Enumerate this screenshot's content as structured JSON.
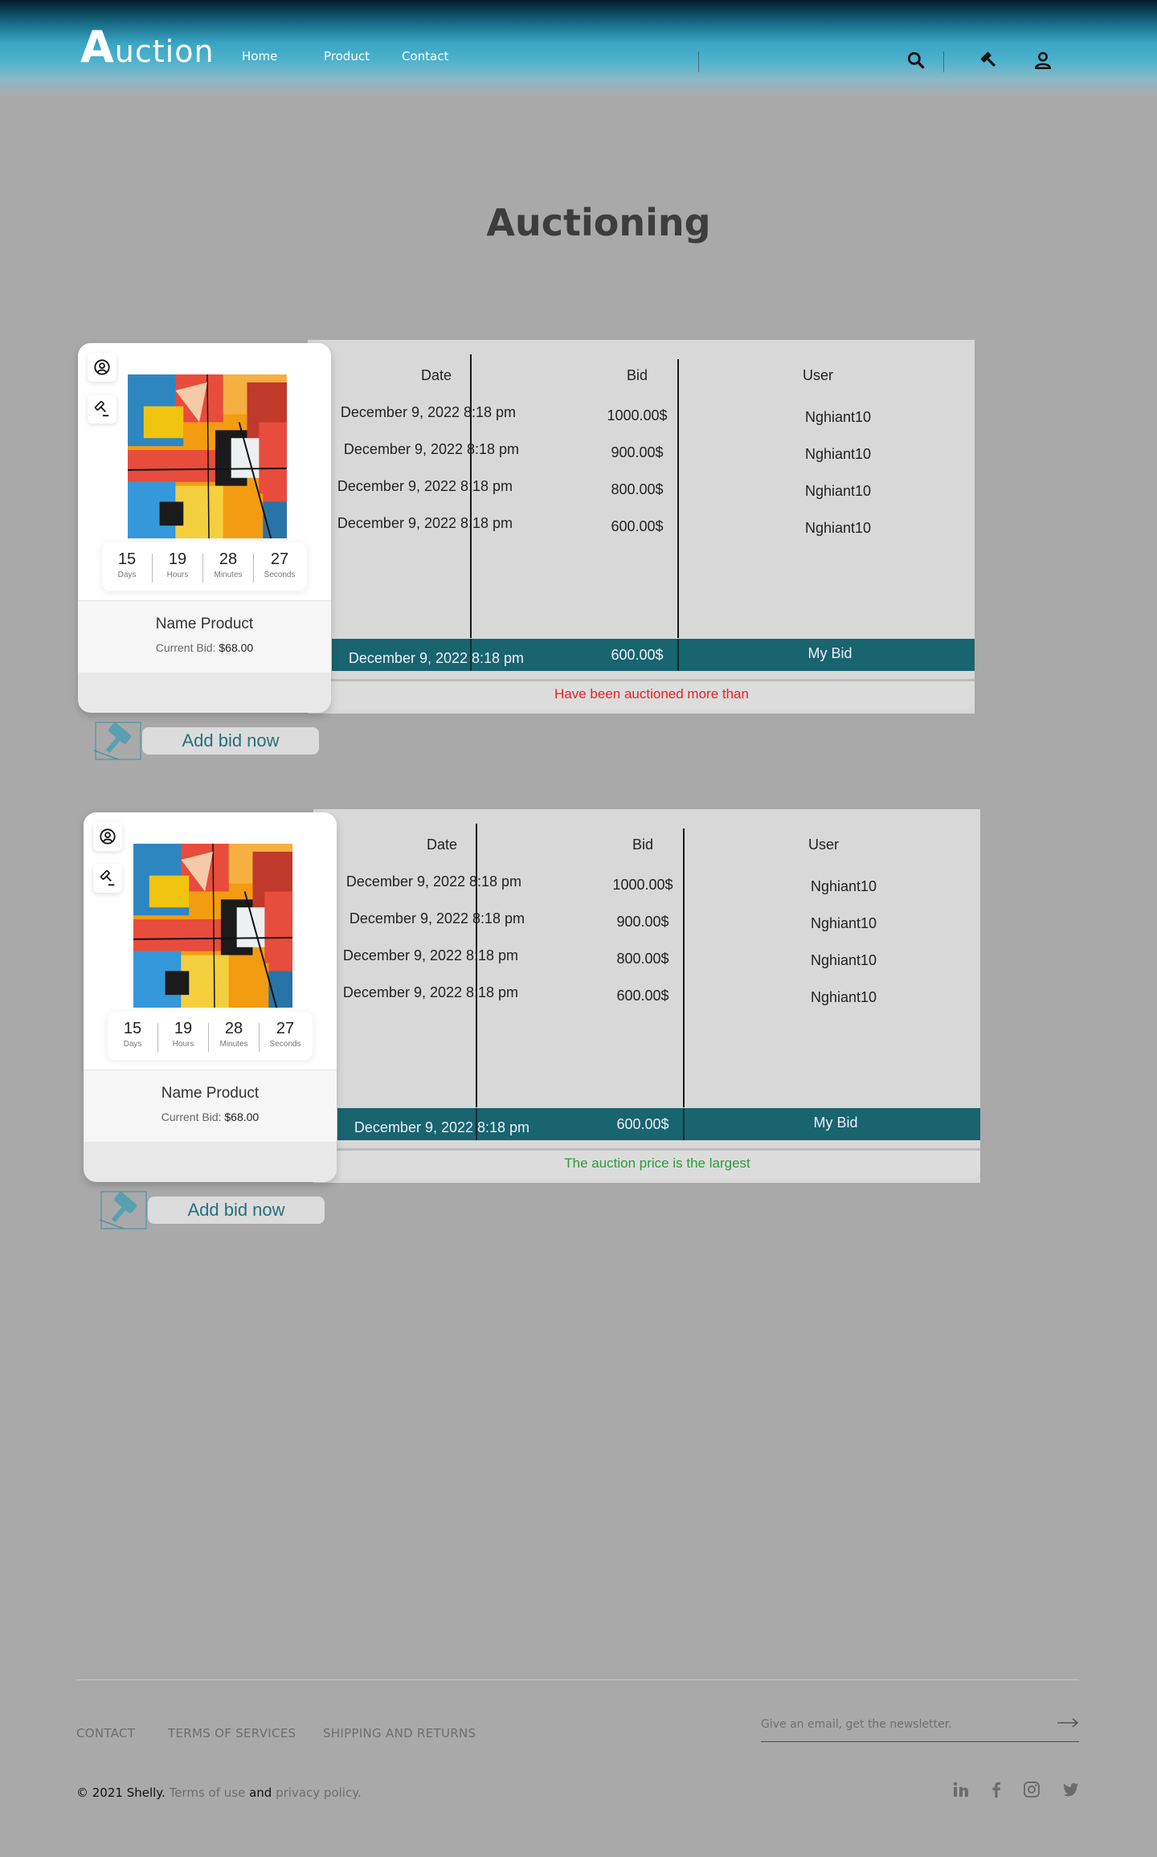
{
  "header": {
    "logo_initial": "A",
    "logo_rest": "uction",
    "nav": [
      "Home",
      "Product",
      "Contact"
    ],
    "icons": [
      "search-icon",
      "gavel-icon",
      "user-icon"
    ]
  },
  "page": {
    "title": "Auctioning"
  },
  "table_headers": {
    "date": "Date",
    "bid": "Bid",
    "user": "User"
  },
  "auctions": [
    {
      "rows": [
        {
          "date": "December 9, 2022 8:18 pm",
          "bid": "1000.00$",
          "user": "Nghiant10"
        },
        {
          "date": "December 9, 2022 8:18 pm",
          "bid": "900.00$",
          "user": "Nghiant10"
        },
        {
          "date": "December 9, 2022 8:18 pm",
          "bid": "800.00$",
          "user": "Nghiant10"
        },
        {
          "date": "December 9, 2022 8:18 pm",
          "bid": "600.00$",
          "user": "Nghiant10"
        }
      ],
      "my_bid": {
        "date": "December 9, 2022 8:18 pm",
        "bid": "600.00$",
        "label": "My Bid"
      },
      "status": {
        "text": "Have been auctioned more than",
        "color": "#e02424"
      },
      "card": {
        "countdown": [
          {
            "value": "15",
            "label": "Days"
          },
          {
            "value": "19",
            "label": "Hours"
          },
          {
            "value": "28",
            "label": "Minutes"
          },
          {
            "value": "27",
            "label": "Seconds"
          }
        ],
        "name": "Name Product",
        "current_bid_label": "Current Bid:",
        "current_bid_value": "$68.00"
      },
      "add_bid_label": "Add bid now"
    },
    {
      "rows": [
        {
          "date": "December 9, 2022 8:18 pm",
          "bid": "1000.00$",
          "user": "Nghiant10"
        },
        {
          "date": "December 9, 2022 8:18 pm",
          "bid": "900.00$",
          "user": "Nghiant10"
        },
        {
          "date": "December 9, 2022 8:18 pm",
          "bid": "800.00$",
          "user": "Nghiant10"
        },
        {
          "date": "December 9, 2022 8:18 pm",
          "bid": "600.00$",
          "user": "Nghiant10"
        }
      ],
      "my_bid": {
        "date": "December 9, 2022 8:18 pm",
        "bid": "600.00$",
        "label": "My Bid"
      },
      "status": {
        "text": "The auction price is the largest",
        "color": "#2e9a3a"
      },
      "card": {
        "countdown": [
          {
            "value": "15",
            "label": "Days"
          },
          {
            "value": "19",
            "label": "Hours"
          },
          {
            "value": "28",
            "label": "Minutes"
          },
          {
            "value": "27",
            "label": "Seconds"
          }
        ],
        "name": "Name Product",
        "current_bid_label": "Current Bid:",
        "current_bid_value": "$68.00"
      },
      "add_bid_label": "Add bid now"
    }
  ],
  "footer": {
    "links": [
      "CONTACT",
      "TERMS OF SERVICES",
      "SHIPPING AND RETURNS"
    ],
    "newsletter_placeholder": "Give an email, get the newsletter.",
    "copyright_main": "© 2021 Shelly.",
    "copyright_terms": "Terms of use",
    "copyright_and": "and",
    "copyright_privacy": "privacy policy.",
    "social": [
      "linkedin-icon",
      "facebook-icon",
      "instagram-icon",
      "twitter-icon"
    ]
  },
  "colors": {
    "accent_teal": "#18646f",
    "add_bid_text": "#28707c",
    "page_bg": "#a9a9a9"
  }
}
